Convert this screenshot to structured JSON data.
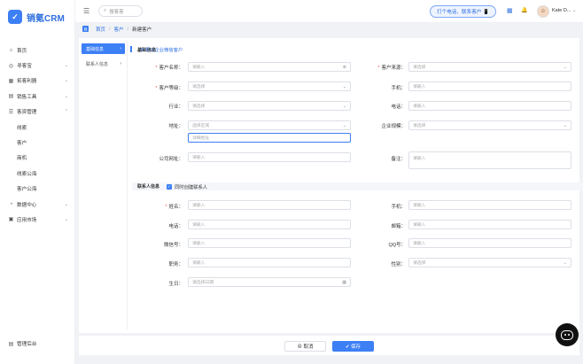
{
  "app": {
    "logo_mark": "✓",
    "title": "销氪CRM"
  },
  "sidebar": {
    "items": [
      {
        "label": "首页",
        "icon": "⌂",
        "chevron": ""
      },
      {
        "label": "寻客宝",
        "icon": "◎",
        "chevron": "⌄"
      },
      {
        "label": "拓客利器",
        "icon": "▦",
        "chevron": "⌄"
      },
      {
        "label": "销售工具",
        "icon": "▤",
        "chevron": "⌄"
      },
      {
        "label": "客资管理",
        "icon": "☰",
        "chevron": "⌃"
      },
      {
        "label": "线索",
        "sub": true
      },
      {
        "label": "客户",
        "sub": true
      },
      {
        "label": "商机",
        "sub": true
      },
      {
        "label": "线索公海",
        "sub": true
      },
      {
        "label": "客户公海",
        "sub": true
      },
      {
        "label": "数据中心",
        "icon": "◔",
        "chevron": "⌄"
      },
      {
        "label": "应用市场",
        "icon": "▣",
        "chevron": "⌄"
      }
    ],
    "bottom": {
      "label": "管理后台",
      "icon": "▤"
    }
  },
  "topbar": {
    "menu_icon": "☰",
    "search_icon": "⌕",
    "search_placeholder": "搜客客",
    "call_button": "打个电话、联系客户 📱",
    "calendar_icon": "▦",
    "bell_icon": "🔔",
    "avatar": "☺",
    "user_name": "Kate D...",
    "user_chevron": "⌄"
  },
  "breadcrumb": {
    "icon": "▤",
    "items": [
      "首页",
      "客户",
      "新建客户"
    ],
    "sep": "/"
  },
  "steps": [
    {
      "label": "基础信息",
      "arrow": "›"
    },
    {
      "label": "联系人信息",
      "arrow": "›"
    }
  ],
  "basic": {
    "title": "基础信息",
    "import_link": "⟲ 导入企业微信客户",
    "fields": {
      "name": {
        "label": "客户名称：",
        "placeholder": "请输入",
        "icon": "⊗"
      },
      "source": {
        "label": "客户来源：",
        "placeholder": "请选择"
      },
      "level": {
        "label": "客户等级：",
        "placeholder": "请选择"
      },
      "mobile": {
        "label": "手机：",
        "placeholder": "请输入"
      },
      "industry": {
        "label": "行业：",
        "placeholder": "请选择"
      },
      "phone": {
        "label": "电话：",
        "placeholder": "请输入"
      },
      "address": {
        "label": "地址：",
        "placeholder": "选择区域",
        "detail_placeholder": "详细地址"
      },
      "scale": {
        "label": "企业规模：",
        "placeholder": "请选择"
      },
      "website": {
        "label": "公司网址：",
        "placeholder": "请输入"
      },
      "remark": {
        "label": "备注：",
        "placeholder": "请输入"
      }
    }
  },
  "contact": {
    "title": "联系人信息",
    "checkbox_label": "同时创建联系人",
    "check_mark": "✓",
    "fields": {
      "name": {
        "label": "姓名：",
        "placeholder": "请输入"
      },
      "mobile": {
        "label": "手机：",
        "placeholder": "请输入"
      },
      "phone": {
        "label": "电话：",
        "placeholder": "请输入"
      },
      "email": {
        "label": "邮箱：",
        "placeholder": "请输入"
      },
      "wechat": {
        "label": "微信号：",
        "placeholder": "请输入"
      },
      "qq": {
        "label": "QQ号：",
        "placeholder": "请输入"
      },
      "position": {
        "label": "职务：",
        "placeholder": "请输入"
      },
      "gender": {
        "label": "性别：",
        "placeholder": "请选择"
      },
      "birthday": {
        "label": "生日：",
        "placeholder": "请选择日期",
        "icon": "▦"
      }
    }
  },
  "footer": {
    "cancel": "⊗ 取消",
    "save": "✔ 保存"
  },
  "chevron": "⌄"
}
